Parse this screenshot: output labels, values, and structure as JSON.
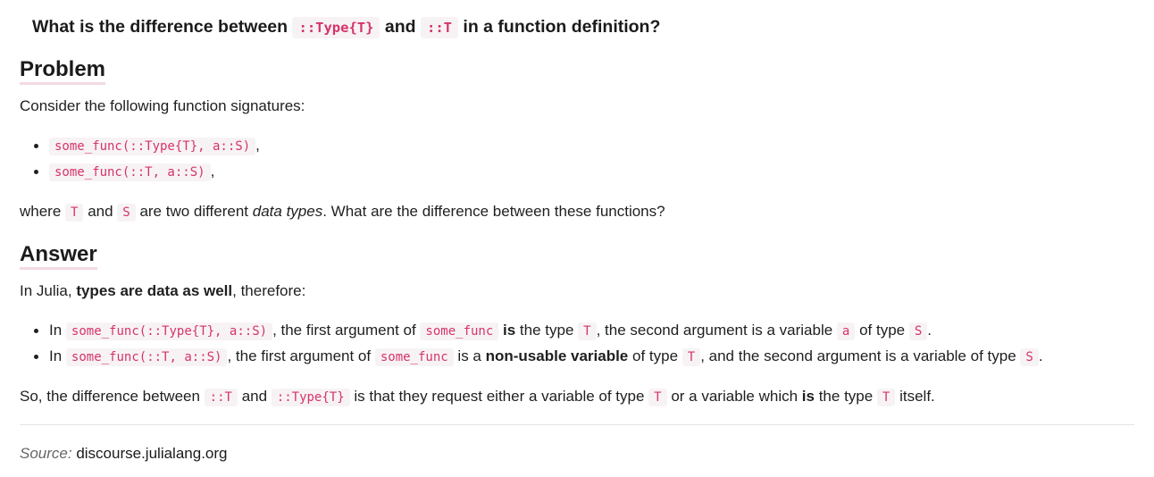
{
  "title": {
    "prefix": "What is the difference between ",
    "code1": "::Type{T}",
    "mid": " and ",
    "code2": "::T",
    "suffix": " in a function definition?"
  },
  "problem": {
    "heading": "Problem",
    "intro": "Consider the following function signatures:",
    "signatures": [
      {
        "code": "some_func(::Type{T}, a::S)",
        "after": ","
      },
      {
        "code": "some_func(::T, a::S)",
        "after": ","
      }
    ],
    "where": {
      "t1": "where ",
      "c1": "T",
      "t2": " and ",
      "c2": "S",
      "t3": " are two different ",
      "em": "data types",
      "t4": ". What are the difference between these functions?"
    }
  },
  "answer": {
    "heading": "Answer",
    "intro": {
      "t1": "In Julia, ",
      "strong": "types are data as well",
      "t2": ", therefore:"
    },
    "items": [
      {
        "t1": "In ",
        "c1": "some_func(::Type{T}, a::S)",
        "t2": ", the first argument of ",
        "c2": "some_func",
        "strong": "is",
        "t3": " the type ",
        "c3": "T",
        "t4": ", the second argument is a variable ",
        "c4": "a",
        "t5": " of type ",
        "c5": "S",
        "t6": "."
      },
      {
        "t1": "In ",
        "c1": "some_func(::T, a::S)",
        "t2": ", the first argument of ",
        "c2": "some_func",
        "t3": " is a ",
        "strong": "non-usable variable",
        "t4": " of type ",
        "c3": "T",
        "t5": ", and the second argument is a variable of type ",
        "c4": "S",
        "t6": "."
      }
    ],
    "conclusion": {
      "t1": "So, the difference between ",
      "c1": "::T",
      "t2": " and ",
      "c2": "::Type{T}",
      "t3": " is that they request either a variable of type ",
      "c3": "T",
      "t4": " or a variable which ",
      "strong": "is",
      "t5": " the type ",
      "c4": "T",
      "t6": " itself."
    }
  },
  "source": {
    "label": "Source:",
    "text": "discourse.julialang.org"
  }
}
